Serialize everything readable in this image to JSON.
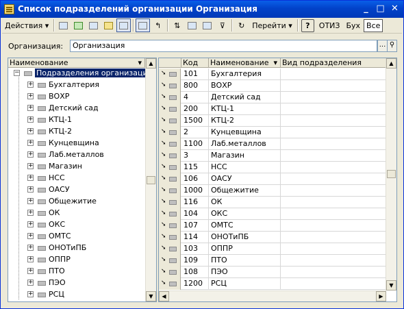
{
  "window": {
    "title": "Список подразделений организации Организация"
  },
  "toolbar": {
    "actions_label": "Действия",
    "goto_label": "Перейти",
    "help_label": "?",
    "otiz_label": "ОТИЗ",
    "buh_label": "Бух",
    "all_label": "Все"
  },
  "org": {
    "label": "Организация:",
    "value": "Организация"
  },
  "tree": {
    "header": "Наименование",
    "root": "Подразделения организаций",
    "items": [
      "Бухгалтерия",
      "ВОХР",
      "Детский сад",
      "КТЦ-1",
      "КТЦ-2",
      "Кунцевщина",
      "Лаб.металлов",
      "Магазин",
      "НСС",
      "ОАСУ",
      "Общежитие",
      "ОК",
      "ОКС",
      "ОМТС",
      "ОНОТиПБ",
      "ОППР",
      "ПТО",
      "ПЭО",
      "РСЦ"
    ]
  },
  "grid": {
    "columns": [
      "Код",
      "Наименование",
      "Вид подразделения"
    ],
    "rows": [
      {
        "code": "101",
        "name": "Бухгалтерия"
      },
      {
        "code": "800",
        "name": "ВОХР"
      },
      {
        "code": "4",
        "name": "Детский сад"
      },
      {
        "code": "200",
        "name": "КТЦ-1"
      },
      {
        "code": "1500",
        "name": "КТЦ-2"
      },
      {
        "code": "2",
        "name": "Кунцевщина"
      },
      {
        "code": "1100",
        "name": "Лаб.металлов"
      },
      {
        "code": "3",
        "name": "Магазин"
      },
      {
        "code": "115",
        "name": "НСС"
      },
      {
        "code": "106",
        "name": "ОАСУ"
      },
      {
        "code": "1000",
        "name": "Общежитие"
      },
      {
        "code": "116",
        "name": "ОК"
      },
      {
        "code": "104",
        "name": "ОКС"
      },
      {
        "code": "107",
        "name": "ОМТС"
      },
      {
        "code": "114",
        "name": "ОНОТиПБ"
      },
      {
        "code": "103",
        "name": "ОППР"
      },
      {
        "code": "109",
        "name": "ПТО"
      },
      {
        "code": "108",
        "name": "ПЭО"
      },
      {
        "code": "1200",
        "name": "РСЦ"
      }
    ]
  }
}
